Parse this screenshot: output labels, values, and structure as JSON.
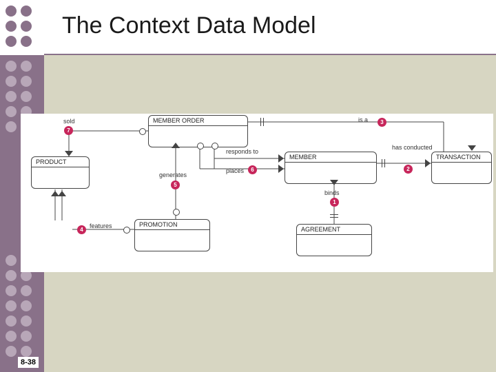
{
  "title": "The Context Data Model",
  "page_number": "8-38",
  "entities": {
    "member_order": "MEMBER ORDER",
    "product": "PRODUCT",
    "promotion": "PROMOTION",
    "member": "MEMBER",
    "agreement": "AGREEMENT",
    "transaction": "TRANSACTION"
  },
  "relationships": {
    "r1": {
      "num": "1",
      "label": "binds"
    },
    "r2": {
      "num": "2",
      "label": "has conducted"
    },
    "r3": {
      "num": "3",
      "label": "is a"
    },
    "r4": {
      "num": "4",
      "label": "features"
    },
    "r5": {
      "num": "5",
      "label": "generates"
    },
    "r6": {
      "num": "6",
      "label": "places"
    },
    "r6b": {
      "label": "responds to"
    },
    "r7": {
      "num": "7",
      "label": "sold"
    }
  },
  "chart_data": {
    "type": "erd",
    "entities": [
      "MEMBER ORDER",
      "PRODUCT",
      "PROMOTION",
      "MEMBER",
      "AGREEMENT",
      "TRANSACTION"
    ],
    "relationships": [
      {
        "id": 1,
        "label": "binds",
        "from": "MEMBER",
        "to": "AGREEMENT"
      },
      {
        "id": 2,
        "label": "has conducted",
        "from": "MEMBER",
        "to": "TRANSACTION"
      },
      {
        "id": 3,
        "label": "is a",
        "from": "MEMBER ORDER",
        "to": "TRANSACTION"
      },
      {
        "id": 4,
        "label": "features",
        "from": "PRODUCT",
        "to": "PROMOTION"
      },
      {
        "id": 5,
        "label": "generates",
        "from": "PROMOTION",
        "to": "MEMBER ORDER"
      },
      {
        "id": 6,
        "label": "places / responds to",
        "from": "MEMBER",
        "to": "MEMBER ORDER"
      },
      {
        "id": 7,
        "label": "sold",
        "from": "MEMBER ORDER",
        "to": "PRODUCT"
      }
    ]
  }
}
